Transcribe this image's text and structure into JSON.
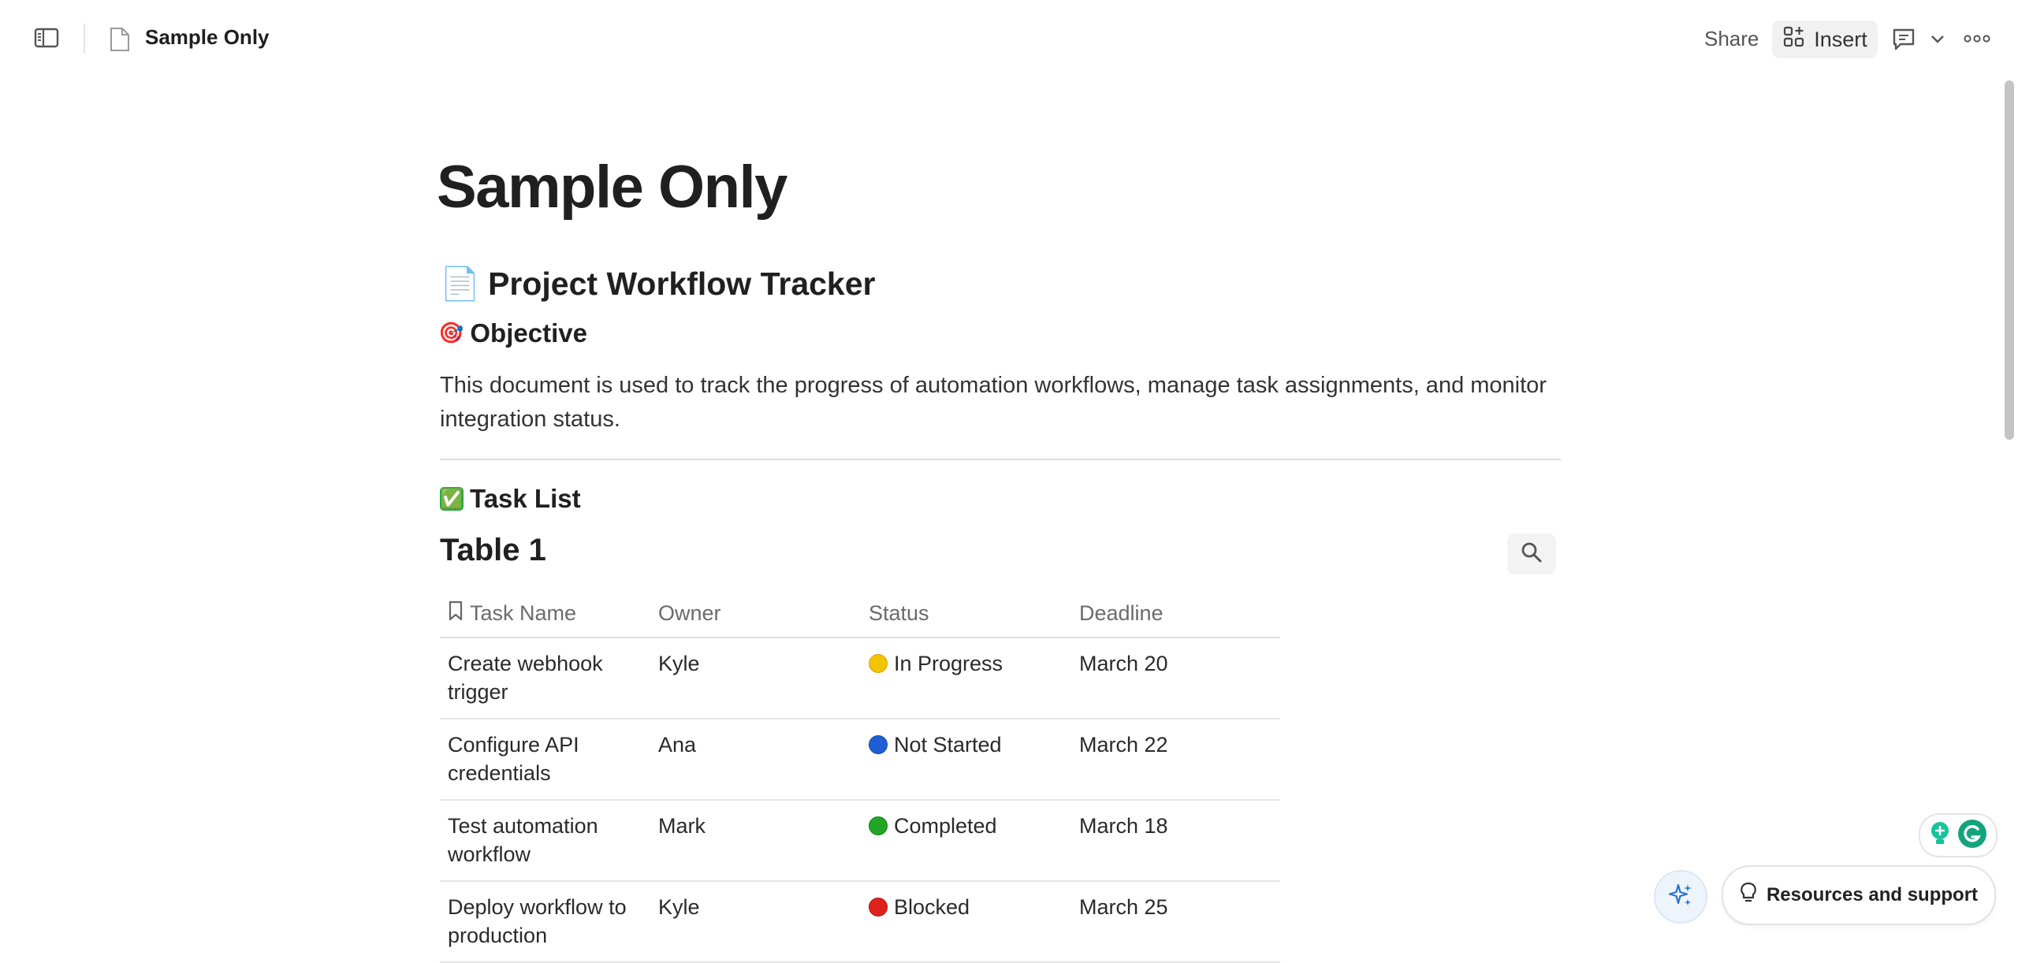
{
  "topbar": {
    "doc_title": "Sample Only",
    "share_label": "Share",
    "insert_label": "Insert"
  },
  "page": {
    "title": "Sample Only",
    "heading": {
      "emoji": "📄",
      "text": "Project Workflow Tracker"
    },
    "objective": {
      "emoji": "🎯",
      "heading": "Objective",
      "text": "This document is used to track the progress of automation workflows, manage task assignments, and monitor integration status."
    },
    "task_list": {
      "emoji": "✅",
      "heading": "Task List"
    },
    "table": {
      "title": "Table 1",
      "columns": [
        "Task Name",
        "Owner",
        "Status",
        "Deadline"
      ],
      "rows": [
        {
          "task": "Create webhook trigger",
          "owner": "Kyle",
          "status": "In Progress",
          "status_color": "#f5c400",
          "deadline": "March 20"
        },
        {
          "task": "Configure API credentials",
          "owner": "Ana",
          "status": "Not Started",
          "status_color": "#1f5fd6",
          "deadline": "March 22"
        },
        {
          "task": "Test automation workflow",
          "owner": "Mark",
          "status": "Completed",
          "status_color": "#22a524",
          "deadline": "March 18"
        },
        {
          "task": "Deploy workflow to production",
          "owner": "Kyle",
          "status": "Blocked",
          "status_color": "#e0221c",
          "deadline": "March 25"
        }
      ]
    }
  },
  "support": {
    "resources_label": "Resources and support"
  },
  "colors": {
    "accent": "#2a72c8",
    "grammarly_green": "#15c39a",
    "text": "#202020"
  }
}
